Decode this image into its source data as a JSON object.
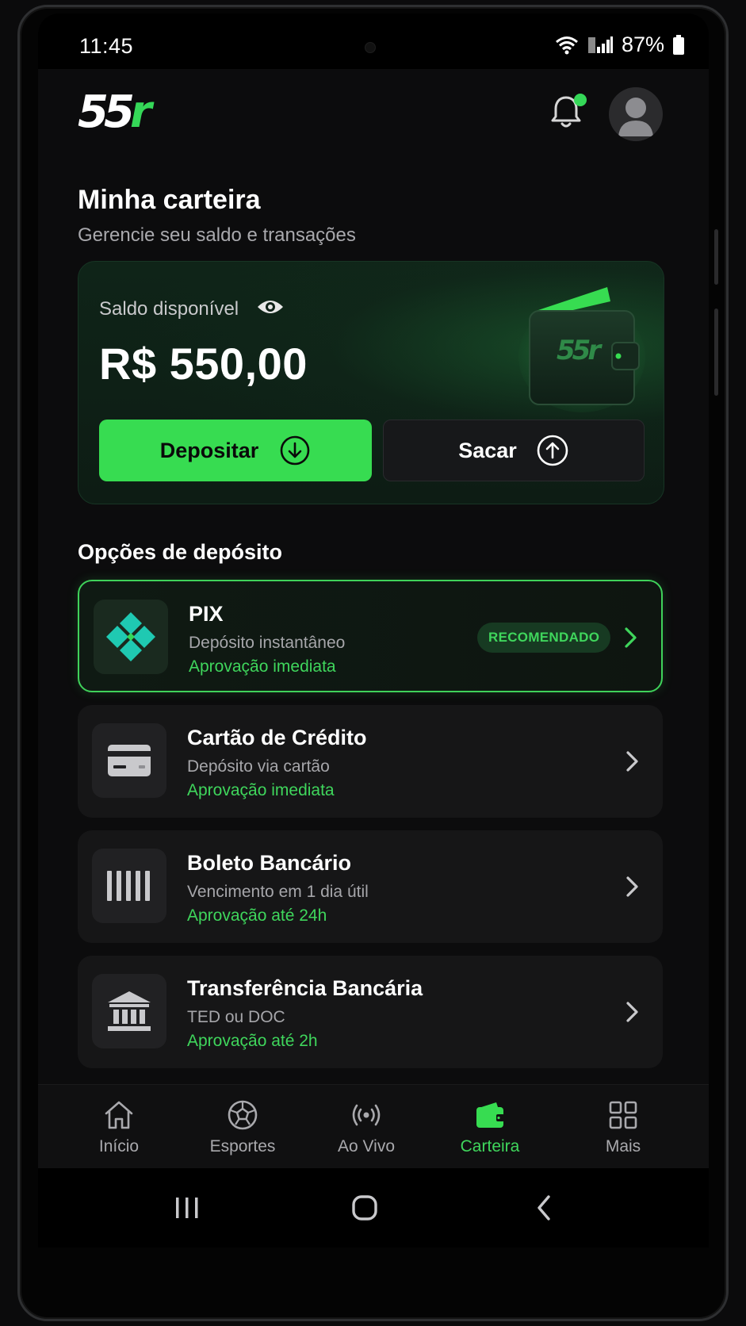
{
  "status_bar": {
    "time": "11:45",
    "battery": "87%"
  },
  "header": {
    "logo_white": "55",
    "logo_green": "r",
    "notification_dot": true
  },
  "page": {
    "title": "Minha carteira",
    "subtitle": "Gerencie seu saldo e transações"
  },
  "balance": {
    "label": "Saldo disponível",
    "value": "R$ 550,00",
    "wallet_logo": "55r",
    "deposit_label": "Depositar",
    "withdraw_label": "Sacar"
  },
  "deposit_section": {
    "title": "Opções de depósito"
  },
  "options": [
    {
      "title": "PIX",
      "subtitle": "Depósito instantâneo",
      "approval": "Aprovação imediata",
      "badge": "RECOMENDADO",
      "icon": "pix-icon"
    },
    {
      "title": "Cartão de Crédito",
      "subtitle": "Depósito via cartão",
      "approval": "Aprovação imediata",
      "icon": "credit-card-icon"
    },
    {
      "title": "Boleto Bancário",
      "subtitle": "Vencimento em 1 dia útil",
      "approval": "Aprovação até 24h",
      "icon": "barcode-icon"
    },
    {
      "title": "Transferência Bancária",
      "subtitle": "TED ou DOC",
      "approval": "Aprovação até 2h",
      "icon": "bank-icon"
    }
  ],
  "nav": [
    {
      "label": "Início",
      "icon": "home-icon"
    },
    {
      "label": "Esportes",
      "icon": "soccer-ball-icon"
    },
    {
      "label": "Ao Vivo",
      "icon": "live-broadcast-icon"
    },
    {
      "label": "Carteira",
      "icon": "wallet-icon",
      "active": true
    },
    {
      "label": "Mais",
      "icon": "grid-icon"
    }
  ],
  "colors": {
    "accent": "#37dc51",
    "background": "#0c0c0d",
    "card": "#161617"
  }
}
